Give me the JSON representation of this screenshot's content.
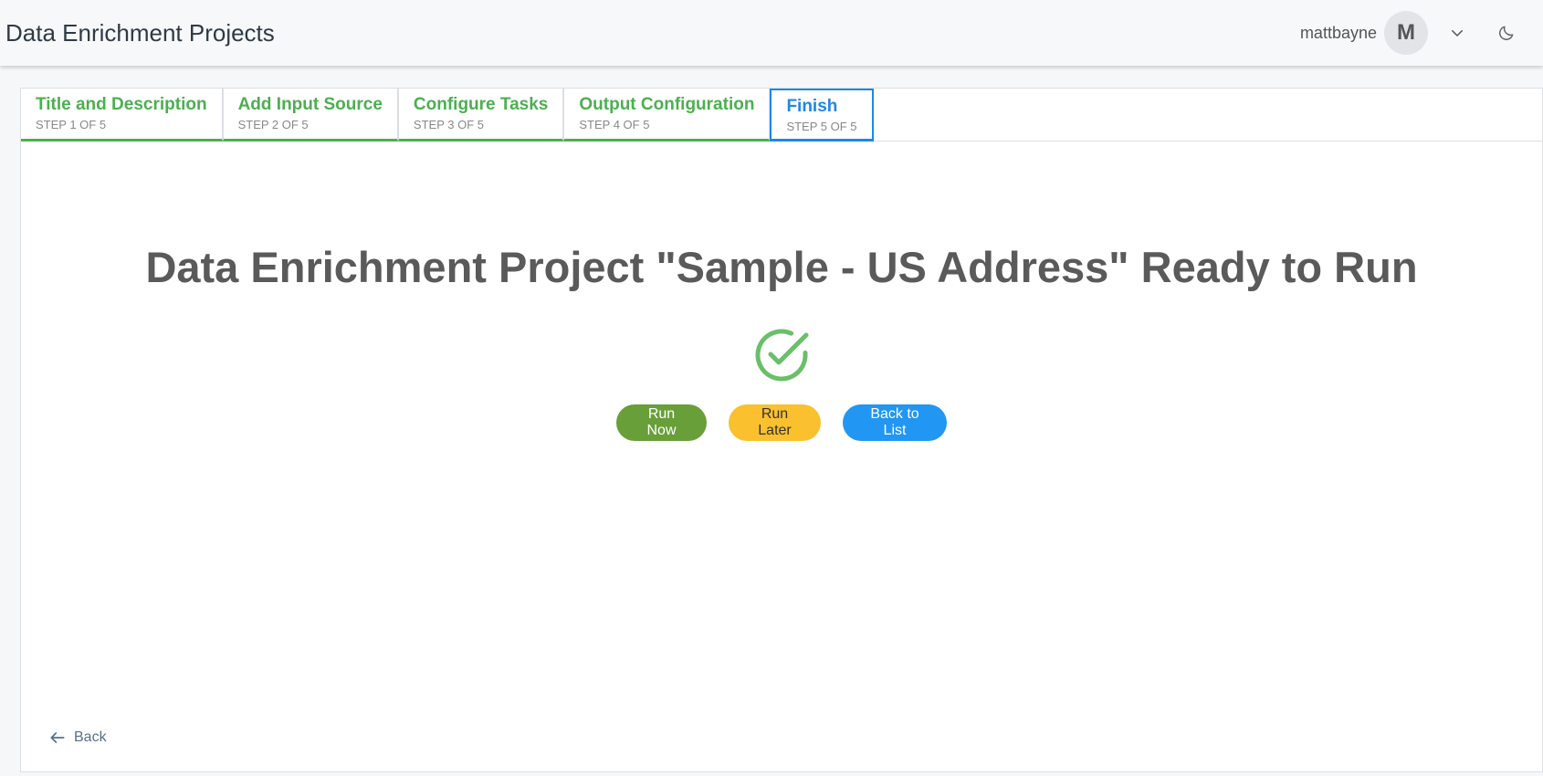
{
  "header": {
    "app_title": "Data Enrichment Projects",
    "username": "mattbayne",
    "avatar_initial": "M"
  },
  "steps": [
    {
      "title": "Title and Description",
      "subtitle": "STEP 1 OF 5",
      "state": "complete"
    },
    {
      "title": "Add Input Source",
      "subtitle": "STEP 2 OF 5",
      "state": "complete"
    },
    {
      "title": "Configure Tasks",
      "subtitle": "STEP 3 OF 5",
      "state": "complete"
    },
    {
      "title": "Output Configuration",
      "subtitle": "STEP 4 OF 5",
      "state": "complete"
    },
    {
      "title": "Finish",
      "subtitle": "STEP 5 OF 5",
      "state": "active"
    }
  ],
  "main": {
    "headline": "Data Enrichment Project \"Sample - US Address\" Ready to Run",
    "status_icon": "check-circle-icon",
    "buttons": {
      "run_now": "Run Now",
      "run_later": "Run Later",
      "back_to_list": "Back to List"
    },
    "back_label": "Back"
  },
  "colors": {
    "step_complete": "#4caf50",
    "step_active": "#1e88e5",
    "check": "#6abf69",
    "run_now": "#689f38",
    "run_later": "#fbc02d",
    "back_to_list": "#2196f3"
  }
}
